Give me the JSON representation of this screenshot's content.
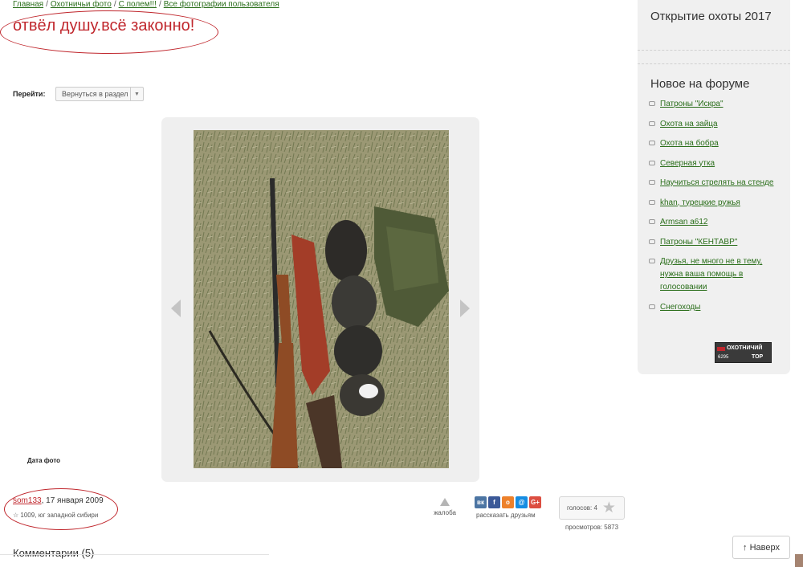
{
  "breadcrumb": {
    "items": [
      "Главная",
      "Охотничьи фото",
      "С полем!!!",
      "Все фотографии пользователя"
    ],
    "separator": "/"
  },
  "page": {
    "title": "отвёл душу.всё законно!"
  },
  "navigation": {
    "goto_label": "Перейти:",
    "goto_select_value": "Вернуться в раздел"
  },
  "photo": {
    "date_label": "Дата фото",
    "image_description_icon": "photo-of-shotgun-and-ducks"
  },
  "author": {
    "name": "som133",
    "date": ", 17 января 2009",
    "rating_icon": "star-outline-icon",
    "meta": "1009, юг западной сибири"
  },
  "actions": {
    "complaint_label": "жалоба",
    "share_label": "рассказать друзьям",
    "share_icons": [
      {
        "name": "vk-icon",
        "glyph": "вк",
        "color": "#4c75a3"
      },
      {
        "name": "facebook-icon",
        "glyph": "f",
        "color": "#3b5998"
      },
      {
        "name": "odnoklassniki-icon",
        "glyph": "о",
        "color": "#ed812b"
      },
      {
        "name": "moimir-icon",
        "glyph": "@",
        "color": "#168de2"
      },
      {
        "name": "googleplus-icon",
        "glyph": "G+",
        "color": "#dc4e41"
      }
    ],
    "votes_label": "голосов: 4",
    "views_label": "просмотров: 5873"
  },
  "comments": {
    "heading": "Комментарии (5)"
  },
  "sidebar": {
    "section1_title": "Открытие охоты 2017",
    "section2_title": "Новое на форуме",
    "forum_items": [
      "Патроны \"Искра\"",
      "Охота на зайца",
      "Охота на бобра",
      "Северная утка",
      "Научиться стрелять на стенде",
      "khan, турецкие ружья",
      "Armsan a612",
      "Патроны \"КЕНТАВР\"",
      "Друзья, не много не в тему, нужна ваша помощь в голосовании",
      "Снегоходы"
    ],
    "badge": {
      "line1": "ОХОТНИЧИЙ",
      "line2": "6295",
      "line3": "ТОР"
    }
  },
  "footer": {
    "back_to_top": "↑ Наверх"
  },
  "colors": {
    "accent_red": "#c0272d",
    "link_green": "#2a6e1a",
    "panel_gray": "#f0f0f0"
  }
}
